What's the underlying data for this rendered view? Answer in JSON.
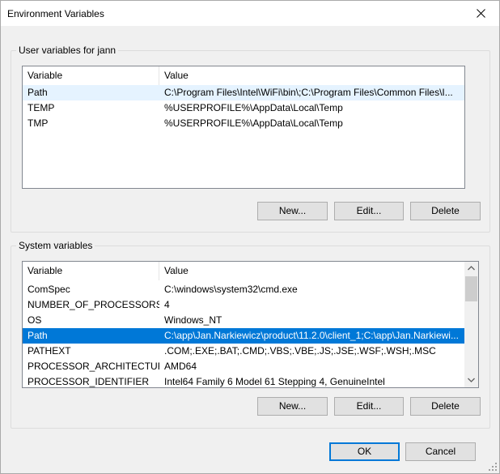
{
  "window": {
    "title": "Environment Variables",
    "close_label": "×"
  },
  "user_group": {
    "label": "User variables for jann",
    "columns": [
      "Variable",
      "Value"
    ],
    "rows": [
      {
        "variable": "Path",
        "value": "C:\\Program Files\\Intel\\WiFi\\bin\\;C:\\Program Files\\Common Files\\I..."
      },
      {
        "variable": "TEMP",
        "value": "%USERPROFILE%\\AppData\\Local\\Temp"
      },
      {
        "variable": "TMP",
        "value": "%USERPROFILE%\\AppData\\Local\\Temp"
      }
    ],
    "new_label": "New...",
    "edit_label": "Edit...",
    "delete_label": "Delete"
  },
  "system_group": {
    "label": "System variables",
    "columns": [
      "Variable",
      "Value"
    ],
    "rows": [
      {
        "variable": "ComSpec",
        "value": "C:\\windows\\system32\\cmd.exe"
      },
      {
        "variable": "NUMBER_OF_PROCESSORS",
        "value": "4"
      },
      {
        "variable": "OS",
        "value": "Windows_NT"
      },
      {
        "variable": "Path",
        "value": "C:\\app\\Jan.Narkiewicz\\product\\11.2.0\\client_1;C:\\app\\Jan.Narkiewi..."
      },
      {
        "variable": "PATHEXT",
        "value": ".COM;.EXE;.BAT;.CMD;.VBS;.VBE;.JS;.JSE;.WSF;.WSH;.MSC"
      },
      {
        "variable": "PROCESSOR_ARCHITECTURE",
        "value": "AMD64"
      },
      {
        "variable": "PROCESSOR_IDENTIFIER",
        "value": "Intel64 Family 6 Model 61 Stepping 4, GenuineIntel"
      }
    ],
    "new_label": "New...",
    "edit_label": "Edit...",
    "delete_label": "Delete"
  },
  "footer": {
    "ok_label": "OK",
    "cancel_label": "Cancel"
  },
  "colors": {
    "selection": "#0078d7",
    "hover": "#e5f3ff"
  }
}
